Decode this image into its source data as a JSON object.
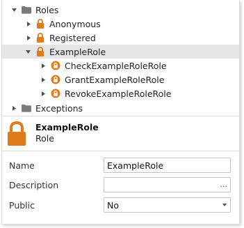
{
  "tree": {
    "roles": {
      "label": "Roles"
    },
    "anonymous": {
      "label": "Anonymous"
    },
    "registered": {
      "label": "Registered"
    },
    "example_role": {
      "label": "ExampleRole"
    },
    "check": {
      "label": "CheckExampleRoleRole"
    },
    "grant": {
      "label": "GrantExampleRoleRole"
    },
    "revoke": {
      "label": "RevokeExampleRoleRole"
    },
    "exceptions": {
      "label": "Exceptions"
    }
  },
  "header": {
    "title": "ExampleRole",
    "subtitle": "Role"
  },
  "properties": {
    "name": {
      "label": "Name",
      "value": "ExampleRole"
    },
    "description": {
      "label": "Description",
      "value": "",
      "button": "..."
    },
    "public": {
      "label": "Public",
      "value": "No"
    }
  },
  "colors": {
    "lock": "#e07b1a",
    "folder": "#808080",
    "selected": "#e6e6e6"
  },
  "icons": {
    "lock": "lock-icon",
    "folder": "folder-icon",
    "expand": "chevron-right-icon",
    "collapse": "chevron-down-icon"
  }
}
